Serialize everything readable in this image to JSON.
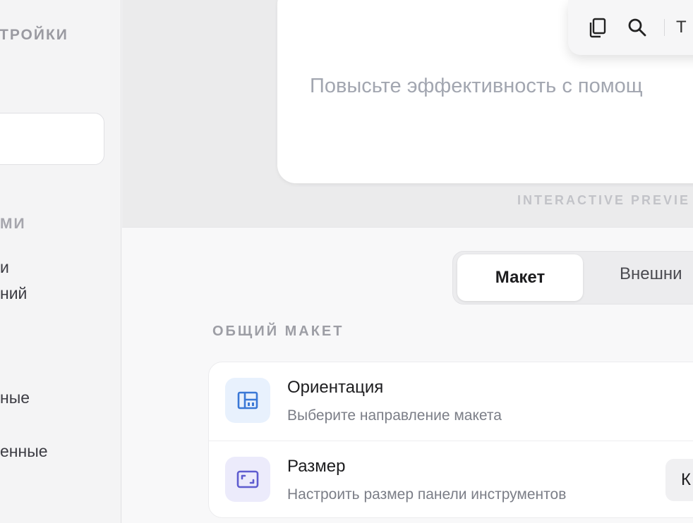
{
  "sidebar": {
    "heading": "ТРОЙКИ",
    "subheading": "МИ",
    "items": [
      {
        "label": "и"
      },
      {
        "label": "ний"
      },
      {
        "label": "ные"
      },
      {
        "label": "енные"
      }
    ]
  },
  "preview": {
    "placeholder": "Повысьте эффективность с помощ",
    "toolbar": {
      "copy_icon": "copy-icon",
      "search_icon": "search-icon",
      "cut_glyph": "T"
    },
    "label": "INTERACTIVE PREVIE"
  },
  "tabs": {
    "active": "Макет",
    "inactive": "Внешни"
  },
  "section": {
    "title": "ОБЩИЙ МАКЕТ",
    "rows": [
      {
        "title": "Ориентация",
        "subtitle": "Выберите направление макета",
        "icon": "layout-icon",
        "icon_color": "#3a78d6",
        "icon_bg": "#e8f1fd"
      },
      {
        "title": "Размер",
        "subtitle": "Настроить размер панели инструментов",
        "icon": "resize-icon",
        "icon_color": "#5e5ccf",
        "icon_bg": "#ecebfb",
        "button_label": "К"
      }
    ]
  }
}
